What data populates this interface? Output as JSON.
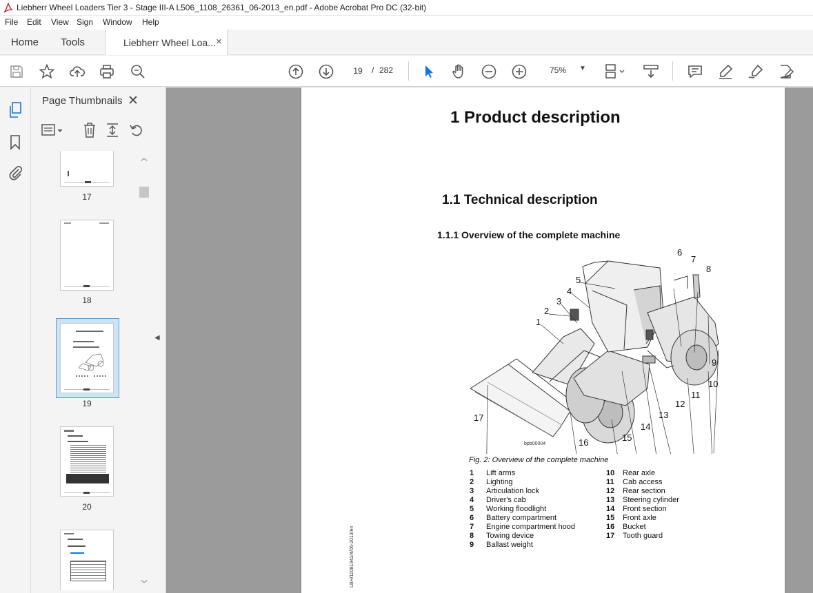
{
  "window": {
    "title": "Liebherr Wheel Loaders Tier 3 - Stage III-A L506_1108_26361_06-2013_en.pdf - Adobe Acrobat Pro DC (32-bit)"
  },
  "menu": [
    "File",
    "Edit",
    "View",
    "Sign",
    "Window",
    "Help"
  ],
  "tabs": {
    "home": "Home",
    "tools": "Tools",
    "document": "Liebherr Wheel Loa...",
    "close": "×"
  },
  "toolbar": {
    "page_current": "19",
    "page_separator": "/",
    "page_total": "282",
    "zoom": "75%"
  },
  "thumbnails": {
    "title": "Page Thumbnails",
    "close": "✕",
    "pages": [
      {
        "num": "17"
      },
      {
        "num": "18"
      },
      {
        "num": "19",
        "selected": true
      },
      {
        "num": "20"
      },
      {
        "num": ""
      }
    ]
  },
  "document": {
    "h1": "1  Product description",
    "h2": "1.1  Technical description",
    "h3": "1.1.1   Overview of the complete machine",
    "figure_id": "bpb00004",
    "caption": "Fig. 2: Overview of the complete machine",
    "side_code": "LBH/11081942/4/06-2013/en",
    "callouts": [
      "1",
      "2",
      "3",
      "4",
      "5",
      "6",
      "7",
      "8",
      "9",
      "10",
      "11",
      "12",
      "13",
      "14",
      "15",
      "16",
      "17"
    ],
    "legend_left": [
      {
        "n": "1",
        "t": "Lift arms"
      },
      {
        "n": "2",
        "t": "Lighting"
      },
      {
        "n": "3",
        "t": "Articulation lock"
      },
      {
        "n": "4",
        "t": "Driver's cab"
      },
      {
        "n": "5",
        "t": "Working floodlight"
      },
      {
        "n": "6",
        "t": "Battery compartment"
      },
      {
        "n": "7",
        "t": "Engine compartment hood"
      },
      {
        "n": "8",
        "t": "Towing device"
      },
      {
        "n": "9",
        "t": "Ballast weight"
      }
    ],
    "legend_right": [
      {
        "n": "10",
        "t": "Rear axle"
      },
      {
        "n": "11",
        "t": "Cab access"
      },
      {
        "n": "12",
        "t": "Rear section"
      },
      {
        "n": "13",
        "t": "Steering cylinder"
      },
      {
        "n": "14",
        "t": "Front section"
      },
      {
        "n": "15",
        "t": "Front axle"
      },
      {
        "n": "16",
        "t": "Bucket"
      },
      {
        "n": "17",
        "t": "Tooth guard"
      }
    ]
  },
  "colors": {
    "acrobat_red": "#d4232b",
    "selection_blue": "#5b9bd5",
    "canvas_gray": "#9b9b9b",
    "cursor_blue": "#1473e6"
  }
}
